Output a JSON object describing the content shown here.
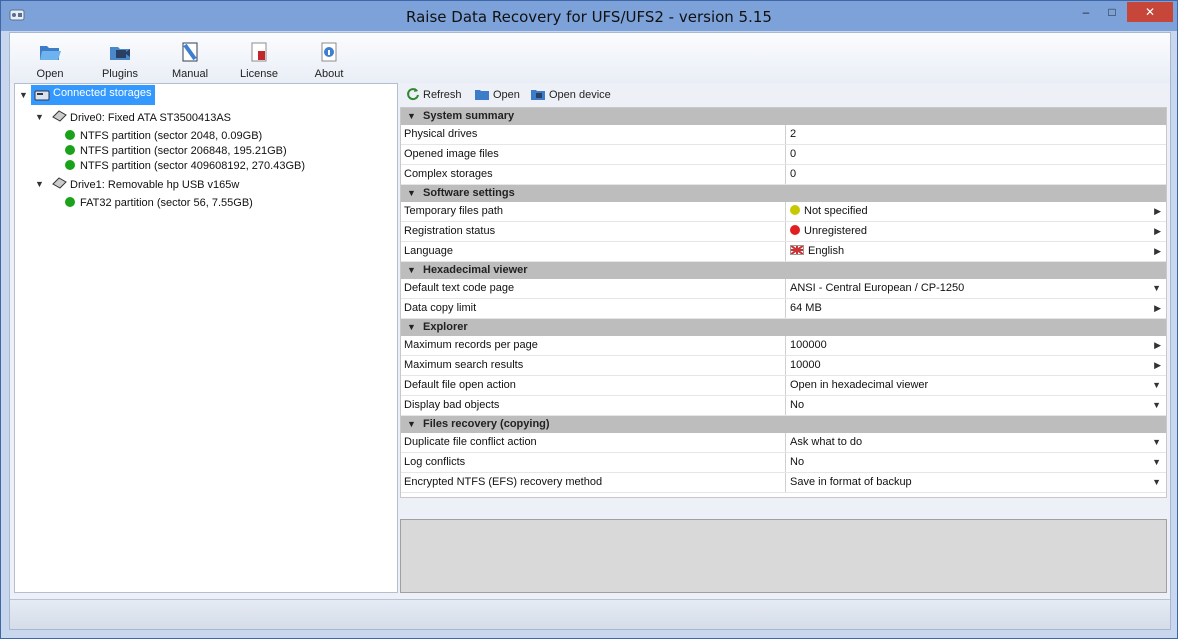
{
  "window": {
    "title": "Raise Data Recovery for UFS/UFS2 - version 5.15",
    "controls": {
      "minimize": "–",
      "maximize": "□",
      "close": "✕"
    }
  },
  "toolbar": {
    "items": [
      {
        "label": "Open",
        "icon": "folder-open-icon"
      },
      {
        "label": "Plugins",
        "icon": "plugins-icon"
      },
      {
        "label": "Manual",
        "icon": "manual-book-icon"
      },
      {
        "label": "License",
        "icon": "license-icon"
      },
      {
        "label": "About",
        "icon": "about-info-icon"
      }
    ]
  },
  "tree": {
    "root": "Connected storages",
    "drives": [
      {
        "label": "Drive0: Fixed ATA ST3500413AS",
        "partitions": [
          "NTFS partition (sector 2048, 0.09GB)",
          "NTFS partition (sector 206848, 195.21GB)",
          "NTFS partition (sector 409608192, 270.43GB)"
        ]
      },
      {
        "label": "Drive1: Removable hp USB v165w",
        "partitions": [
          "FAT32 partition (sector 56, 7.55GB)"
        ]
      }
    ]
  },
  "right_toolbar": {
    "refresh": "Refresh",
    "open": "Open",
    "open_device": "Open device"
  },
  "properties": {
    "sections": [
      {
        "title": "System summary",
        "rows": [
          {
            "name": "Physical drives",
            "value": "2"
          },
          {
            "name": "Opened image files",
            "value": "0"
          },
          {
            "name": "Complex storages",
            "value": "0"
          }
        ]
      },
      {
        "title": "Software settings",
        "rows": [
          {
            "name": "Temporary files path",
            "value": "Not specified"
          },
          {
            "name": "Registration status",
            "value": "Unregistered"
          },
          {
            "name": "Language",
            "value": "English"
          }
        ]
      },
      {
        "title": "Hexadecimal viewer",
        "rows": [
          {
            "name": "Default text code page",
            "value": "ANSI - Central European / CP-1250"
          },
          {
            "name": "Data copy limit",
            "value": "64 MB"
          }
        ]
      },
      {
        "title": "Explorer",
        "rows": [
          {
            "name": "Maximum records per page",
            "value": "100000"
          },
          {
            "name": "Maximum search results",
            "value": "10000"
          },
          {
            "name": "Default file open action",
            "value": "Open in hexadecimal viewer"
          },
          {
            "name": "Display bad objects",
            "value": "No"
          }
        ]
      },
      {
        "title": "Files recovery (copying)",
        "rows": [
          {
            "name": "Duplicate file conflict action",
            "value": "Ask what to do"
          },
          {
            "name": "Log conflicts",
            "value": "No"
          },
          {
            "name": "Encrypted NTFS (EFS) recovery method",
            "value": "Save in format of backup"
          }
        ]
      }
    ]
  },
  "colors": {
    "indicator_yellow": "#c8c800",
    "indicator_red": "#e02020",
    "partition_green": "#1aa21a",
    "selection_blue": "#3399ff"
  }
}
